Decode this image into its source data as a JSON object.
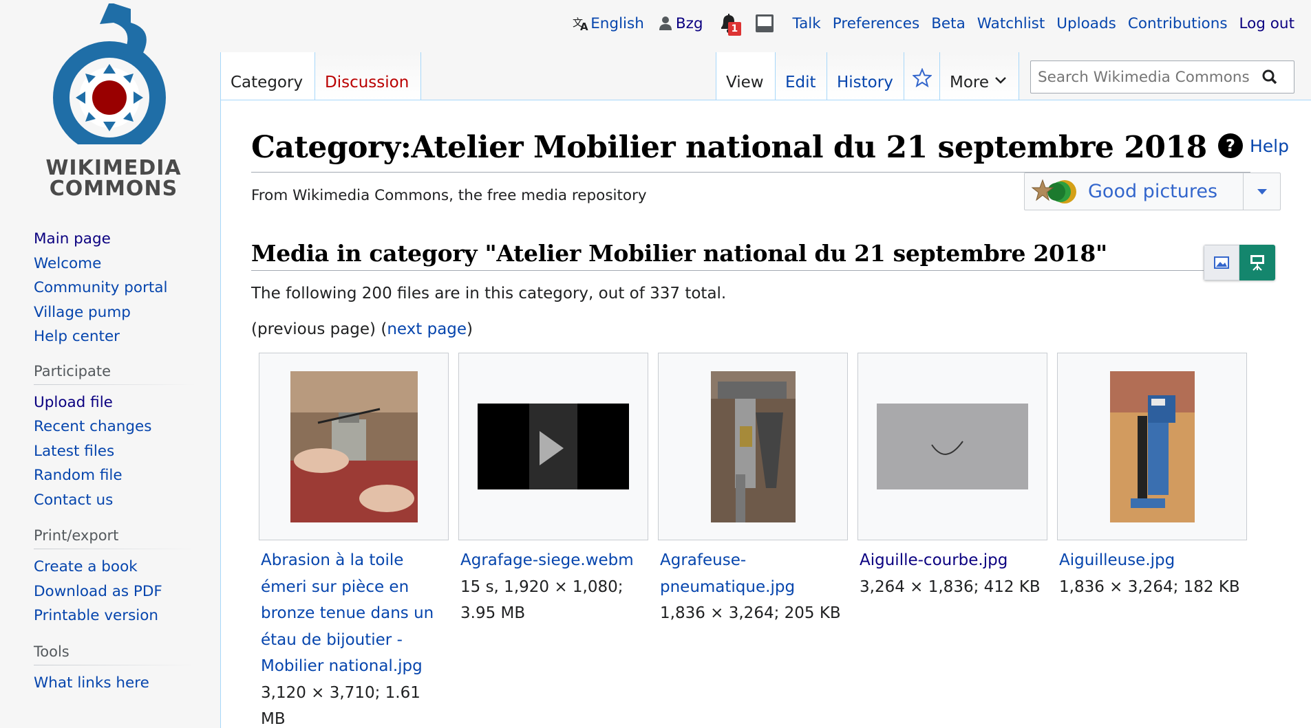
{
  "personal": {
    "language": "English",
    "username": "Bzg",
    "notification_count": "1",
    "links": [
      "Talk",
      "Preferences",
      "Beta",
      "Watchlist",
      "Uploads",
      "Contributions",
      "Log out"
    ]
  },
  "logo": {
    "line1": "WIKIMEDIA",
    "line2": "COMMONS"
  },
  "sidebar": {
    "navigation": [
      "Main page",
      "Welcome",
      "Community portal",
      "Village pump",
      "Help center"
    ],
    "participate": {
      "heading": "Participate",
      "items": [
        "Upload file",
        "Recent changes",
        "Latest files",
        "Random file",
        "Contact us"
      ]
    },
    "print": {
      "heading": "Print/export",
      "items": [
        "Create a book",
        "Download as PDF",
        "Printable version"
      ]
    },
    "tools": {
      "heading": "Tools",
      "items": [
        "What links here"
      ]
    }
  },
  "tabs": {
    "category": "Category",
    "discussion": "Discussion",
    "view": "View",
    "edit": "Edit",
    "history": "History",
    "more": "More"
  },
  "search": {
    "placeholder": "Search Wikimedia Commons"
  },
  "content": {
    "title": "Category:Atelier Mobilier national du 21 septembre 2018",
    "help": "Help",
    "tagline": "From Wikimedia Commons, the free media repository",
    "good_pictures": "Good pictures",
    "media_heading": "Media in category \"Atelier Mobilier national du 21 septembre 2018\"",
    "count_text": "The following 200 files are in this category, out of 337 total.",
    "paging": {
      "prev": "(previous page) (",
      "next": "next page",
      "close": ")"
    }
  },
  "gallery": [
    {
      "name": "Abrasion à la toile émeri sur pièce en bronze tenue dans un étau de bijoutier - Mobilier national.jpg",
      "meta": "3,120 × 3,710; 1.61 MB"
    },
    {
      "name": "Agrafage-siege.webm",
      "meta": "15 s, 1,920 × 1,080; 3.95 MB"
    },
    {
      "name": "Agrafeuse-pneumatique.jpg",
      "meta": "1,836 × 3,264; 205 KB"
    },
    {
      "name": "Aiguille-courbe.jpg",
      "meta": "3,264 × 1,836; 412 KB"
    },
    {
      "name": "Aiguilleuse.jpg",
      "meta": "1,836 × 3,264; 182 KB"
    }
  ]
}
